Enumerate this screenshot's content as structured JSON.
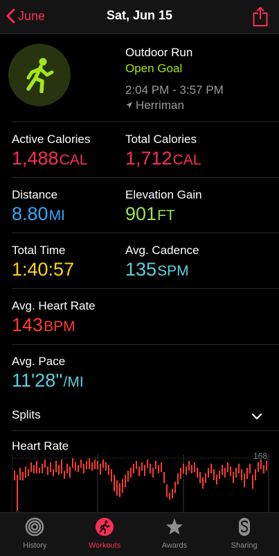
{
  "nav": {
    "back_label": "June",
    "title": "Sat, Jun 15"
  },
  "workout": {
    "type": "Outdoor Run",
    "goal": "Open Goal",
    "time_range": "2:04 PM - 3:57 PM",
    "location": "Herriman",
    "icon": "running-figure-icon"
  },
  "metrics": {
    "active_calories": {
      "label": "Active Calories",
      "value": "1,488",
      "unit": "CAL"
    },
    "total_calories": {
      "label": "Total Calories",
      "value": "1,712",
      "unit": "CAL"
    },
    "distance": {
      "label": "Distance",
      "value": "8.80",
      "unit": "MI"
    },
    "elevation_gain": {
      "label": "Elevation Gain",
      "value": "901",
      "unit": "FT"
    },
    "total_time": {
      "label": "Total Time",
      "value": "1:40:57"
    },
    "avg_cadence": {
      "label": "Avg. Cadence",
      "value": "135",
      "unit": "SPM"
    },
    "avg_heart_rate": {
      "label": "Avg. Heart Rate",
      "value": "143",
      "unit": "BPM"
    },
    "avg_pace": {
      "label": "Avg. Pace",
      "value": "11'28''",
      "unit": "/MI"
    }
  },
  "splits": {
    "label": "Splits"
  },
  "heart_rate": {
    "title": "Heart Rate",
    "max_label": "168"
  },
  "tabs": [
    {
      "label": "History",
      "icon": "history-rings-icon",
      "active": false
    },
    {
      "label": "Workouts",
      "icon": "workouts-runner-icon",
      "active": true
    },
    {
      "label": "Awards",
      "icon": "awards-star-icon",
      "active": false
    },
    {
      "label": "Sharing",
      "icon": "sharing-icon",
      "active": false
    }
  ],
  "colors": {
    "accent": "#fa2d55",
    "goal_green": "#a5e61b",
    "calories": "#ff2d55",
    "distance": "#2fa8ff",
    "elevation": "#99e354",
    "time": "#ffd60a",
    "cadence": "#5ad1e0",
    "heart": "#ff3b30"
  }
}
